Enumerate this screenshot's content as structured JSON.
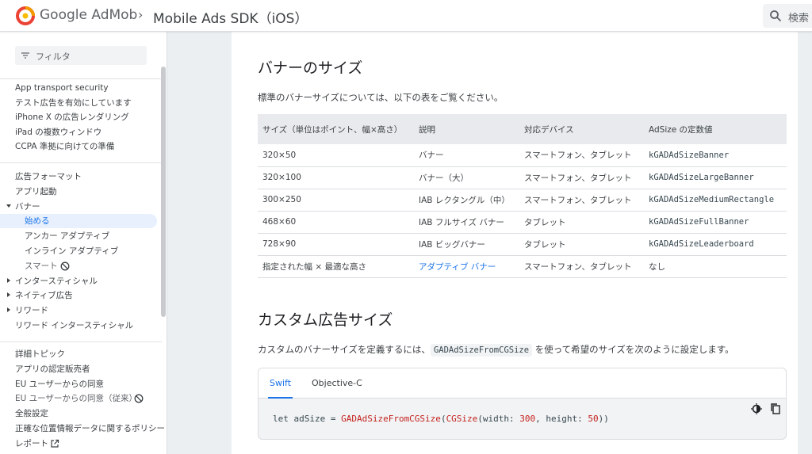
{
  "header": {
    "brand_google": "Google",
    "brand_product": "AdMob",
    "breadcrumb_sep": "›",
    "breadcrumb": "Mobile Ads SDK（iOS）",
    "search_label": "検索",
    "colors": {
      "logo_red": "#ea4335",
      "logo_yellow": "#fbbc04",
      "logo_orange": "#f29900"
    }
  },
  "sidebar": {
    "filter_placeholder": "フィルタ",
    "group1": [
      "App transport security",
      "テスト広告を有効にしています",
      "iPhone X の広告レンダリング",
      "iPad の複数ウィンドウ",
      "CCPA 準拠に向けての準備"
    ],
    "group2": [
      {
        "label": "広告フォーマット",
        "arrow": ""
      },
      {
        "label": "アプリ起動",
        "arrow": ""
      },
      {
        "label": "バナー",
        "arrow": "down"
      },
      {
        "label": "始める",
        "arrow": "",
        "indent": true,
        "active": true
      },
      {
        "label": "アンカー アダプティブ",
        "arrow": "",
        "indent": true
      },
      {
        "label": "インライン アダプティブ",
        "arrow": "",
        "indent": true
      },
      {
        "label": "スマート",
        "arrow": "",
        "indent": true,
        "muted": true,
        "deprecated": true
      },
      {
        "label": "インタースティシャル",
        "arrow": "right"
      },
      {
        "label": "ネイティブ広告",
        "arrow": "right"
      },
      {
        "label": "リワード",
        "arrow": "right"
      },
      {
        "label": "リワード インタースティシャル",
        "arrow": ""
      }
    ],
    "group3": [
      {
        "label": "詳細トピック"
      },
      {
        "label": "アプリの認定販売者"
      },
      {
        "label": "EU ユーザーからの同意"
      },
      {
        "label": "EU ユーザーからの同意（従来）",
        "muted": true,
        "deprecated": true
      },
      {
        "label": "全般設定"
      },
      {
        "label": "正確な位置情報データに関するポリシー"
      },
      {
        "label": "レポート",
        "external": true
      }
    ]
  },
  "main": {
    "section1_title": "バナーのサイズ",
    "section1_intro": "標準のバナーサイズについては、以下の表をご覧ください。",
    "table": {
      "headers": [
        "サイズ（単位はポイント、幅×高さ）",
        "説明",
        "対応デバイス",
        "AdSize の定数値"
      ],
      "rows": [
        [
          "320×50",
          "バナー",
          "スマートフォン、タブレット",
          "kGADAdSizeBanner"
        ],
        [
          "320×100",
          "バナー（大）",
          "スマートフォン、タブレット",
          "kGADAdSizeLargeBanner"
        ],
        [
          "300×250",
          "IAB レクタングル（中）",
          "スマートフォン、タブレット",
          "kGADAdSizeMediumRectangle"
        ],
        [
          "468×60",
          "IAB フルサイズ バナー",
          "タブレット",
          "kGADAdSizeFullBanner"
        ],
        [
          "728×90",
          "IAB ビッグバナー",
          "タブレット",
          "kGADAdSizeLeaderboard"
        ],
        [
          "指定された幅 × 最適な高さ",
          "アダプティブ バナー",
          "スマートフォン、タブレット",
          "なし"
        ]
      ]
    },
    "section2_title": "カスタム広告サイズ",
    "section2_pre": "カスタムのバナーサイズを定義するには、",
    "section2_code": "GADAdSizeFromCGSize",
    "section2_post": " を使って希望のサイズを次のように設定します。",
    "code_tabs": [
      "Swift",
      "Objective-C"
    ],
    "code": {
      "kw": "let adSize = ",
      "fn": "GADAdSizeFromCGSize",
      "p1": "(",
      "ty": "CGSize",
      "p2": "(width: ",
      "n1": "300",
      "p3": ", height: ",
      "n2": "50",
      "p4": "))"
    }
  }
}
